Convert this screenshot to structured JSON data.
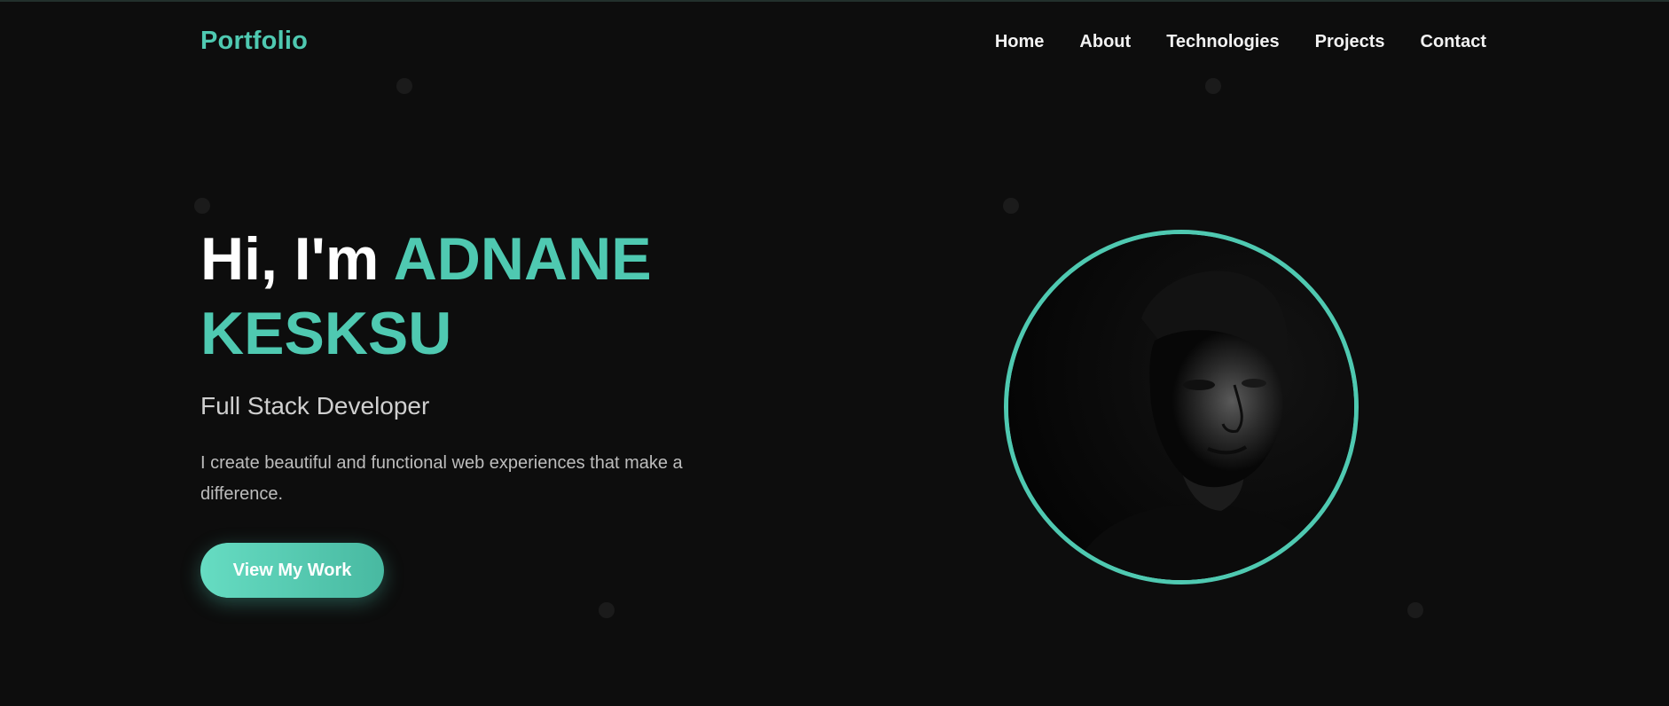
{
  "navbar": {
    "brand": "Portfolio",
    "links": [
      "Home",
      "About",
      "Technologies",
      "Projects",
      "Contact"
    ]
  },
  "hero": {
    "greeting": "Hi, I'm",
    "name_first": "ADNANE",
    "name_last": "KESKSU",
    "subtitle": "Full Stack Developer",
    "description": "I create beautiful and functional web experiences that make a difference.",
    "cta_label": "View My Work"
  },
  "profile_image": {
    "icon": "profile-photo",
    "description_hidden": true
  },
  "colors": {
    "background": "#0d0d0d",
    "accent": "#4fc9b1",
    "text_primary": "#ffffff",
    "text_secondary": "#bdbdbd"
  }
}
